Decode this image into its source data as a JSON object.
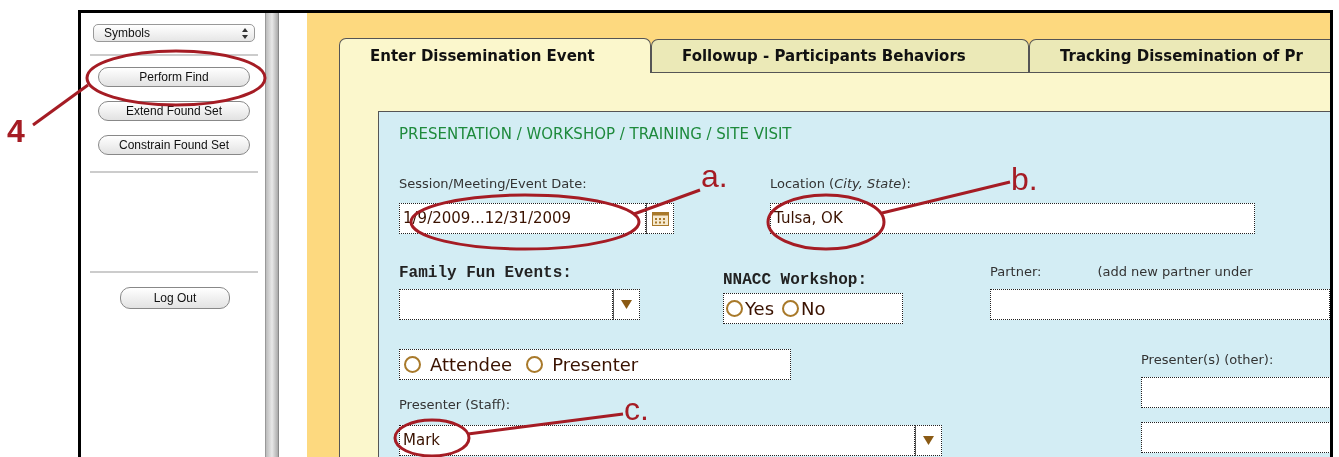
{
  "sidebar": {
    "dropdown": {
      "value": "Symbols"
    },
    "buttons": [
      "Perform Find",
      "Extend Found Set",
      "Constrain Found Set"
    ],
    "logout_button": "Log Out"
  },
  "tabs": [
    {
      "label": "Enter Dissemination Event",
      "selected": true
    },
    {
      "label": "Followup - Participants Behaviors",
      "selected": false
    },
    {
      "label": "Tracking Dissemination of Pr",
      "selected": false
    }
  ],
  "form": {
    "section_title": "PRESENTATION / WORKSHOP / TRAINING / SITE VISIT",
    "event_date": {
      "label": "Session/Meeting/Event Date:",
      "value": "1/9/2009...12/31/2009"
    },
    "location": {
      "label": "Location (*City, State*):",
      "value": "Tulsa, OK"
    },
    "family_fun_events": {
      "label": "Family Fun Events:"
    },
    "nnacc_workshop": {
      "label": "NNACC Workshop:",
      "options": [
        {
          "label": "Yes",
          "selected": false
        },
        {
          "label": "No",
          "selected": false
        }
      ]
    },
    "partner": {
      "label": "Partner:",
      "note": "(add new partner under"
    },
    "role": {
      "options": [
        {
          "label": "Attendee",
          "selected": false
        },
        {
          "label": "Presenter",
          "selected": false
        }
      ]
    },
    "presenters_other": {
      "label": "Presenter(s) (other):"
    },
    "presenter_staff": {
      "label": "Presenter (Staff):",
      "value": "Mark"
    }
  },
  "callouts": [
    {
      "label": "4"
    },
    {
      "label": "a."
    },
    {
      "label": "b."
    },
    {
      "label": "c."
    }
  ]
}
